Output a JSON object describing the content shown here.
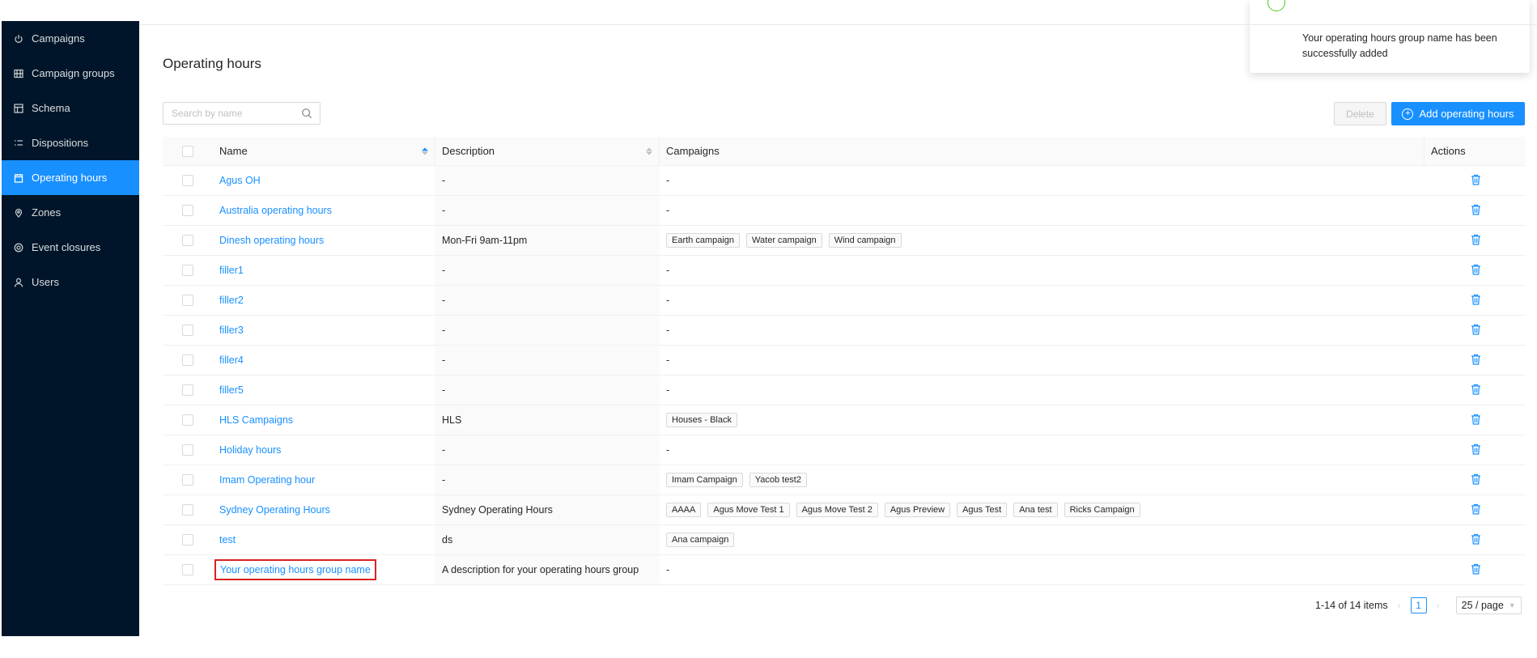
{
  "sidebar": {
    "items": [
      {
        "label": "Campaigns",
        "icon": "power-icon",
        "active": false
      },
      {
        "label": "Campaign groups",
        "icon": "group-icon",
        "active": false
      },
      {
        "label": "Schema",
        "icon": "schema-icon",
        "active": false
      },
      {
        "label": "Dispositions",
        "icon": "list-icon",
        "active": false
      },
      {
        "label": "Operating hours",
        "icon": "calendar-icon",
        "active": true
      },
      {
        "label": "Zones",
        "icon": "location-icon",
        "active": false
      },
      {
        "label": "Event closures",
        "icon": "target-icon",
        "active": false
      },
      {
        "label": "Users",
        "icon": "user-icon",
        "active": false
      }
    ]
  },
  "page": {
    "title": "Operating hours",
    "search_placeholder": "Search by name",
    "delete_label": "Delete",
    "add_label": "Add operating hours"
  },
  "table": {
    "columns": {
      "name": "Name",
      "description": "Description",
      "campaigns": "Campaigns",
      "actions": "Actions"
    },
    "rows": [
      {
        "name": "Agus OH",
        "description": "-",
        "campaigns": [],
        "campaigns_text": "-"
      },
      {
        "name": "Australia operating hours",
        "description": "-",
        "campaigns": [],
        "campaigns_text": "-"
      },
      {
        "name": "Dinesh operating hours",
        "description": "Mon-Fri 9am-11pm",
        "campaigns": [
          "Earth campaign",
          "Water campaign",
          "Wind campaign"
        ],
        "campaigns_text": ""
      },
      {
        "name": "filler1",
        "description": "-",
        "campaigns": [],
        "campaigns_text": "-"
      },
      {
        "name": "filler2",
        "description": "-",
        "campaigns": [],
        "campaigns_text": "-"
      },
      {
        "name": "filler3",
        "description": "-",
        "campaigns": [],
        "campaigns_text": "-"
      },
      {
        "name": "filler4",
        "description": "-",
        "campaigns": [],
        "campaigns_text": "-"
      },
      {
        "name": "filler5",
        "description": "-",
        "campaigns": [],
        "campaigns_text": "-"
      },
      {
        "name": "HLS Campaigns",
        "description": "HLS",
        "campaigns": [
          "Houses - Black"
        ],
        "campaigns_text": ""
      },
      {
        "name": "Holiday hours",
        "description": "-",
        "campaigns": [],
        "campaigns_text": "-"
      },
      {
        "name": "Imam Operating hour",
        "description": "-",
        "campaigns": [
          "Imam Campaign",
          "Yacob test2"
        ],
        "campaigns_text": ""
      },
      {
        "name": "Sydney Operating Hours",
        "description": "Sydney Operating Hours",
        "campaigns": [
          "AAAA",
          "Agus Move Test 1",
          "Agus Move Test 2",
          "Agus Preview",
          "Agus Test",
          "Ana test",
          "Ricks Campaign"
        ],
        "campaigns_text": ""
      },
      {
        "name": "test",
        "description": "ds",
        "campaigns": [
          "Ana campaign"
        ],
        "campaigns_text": ""
      },
      {
        "name": "Your operating hours group name",
        "description": "A description for your operating hours group",
        "campaigns": [],
        "campaigns_text": "-",
        "highlighted": true
      }
    ]
  },
  "pagination": {
    "range_text": "1-14 of 14 items",
    "current_page": "1",
    "page_size": "25 / page"
  },
  "notification": {
    "message": "Your operating hours group name has been successfully added"
  },
  "colors": {
    "primary": "#1890ff",
    "sidebar_bg": "#001529",
    "success": "#52c41a",
    "highlight": "#d92121"
  }
}
